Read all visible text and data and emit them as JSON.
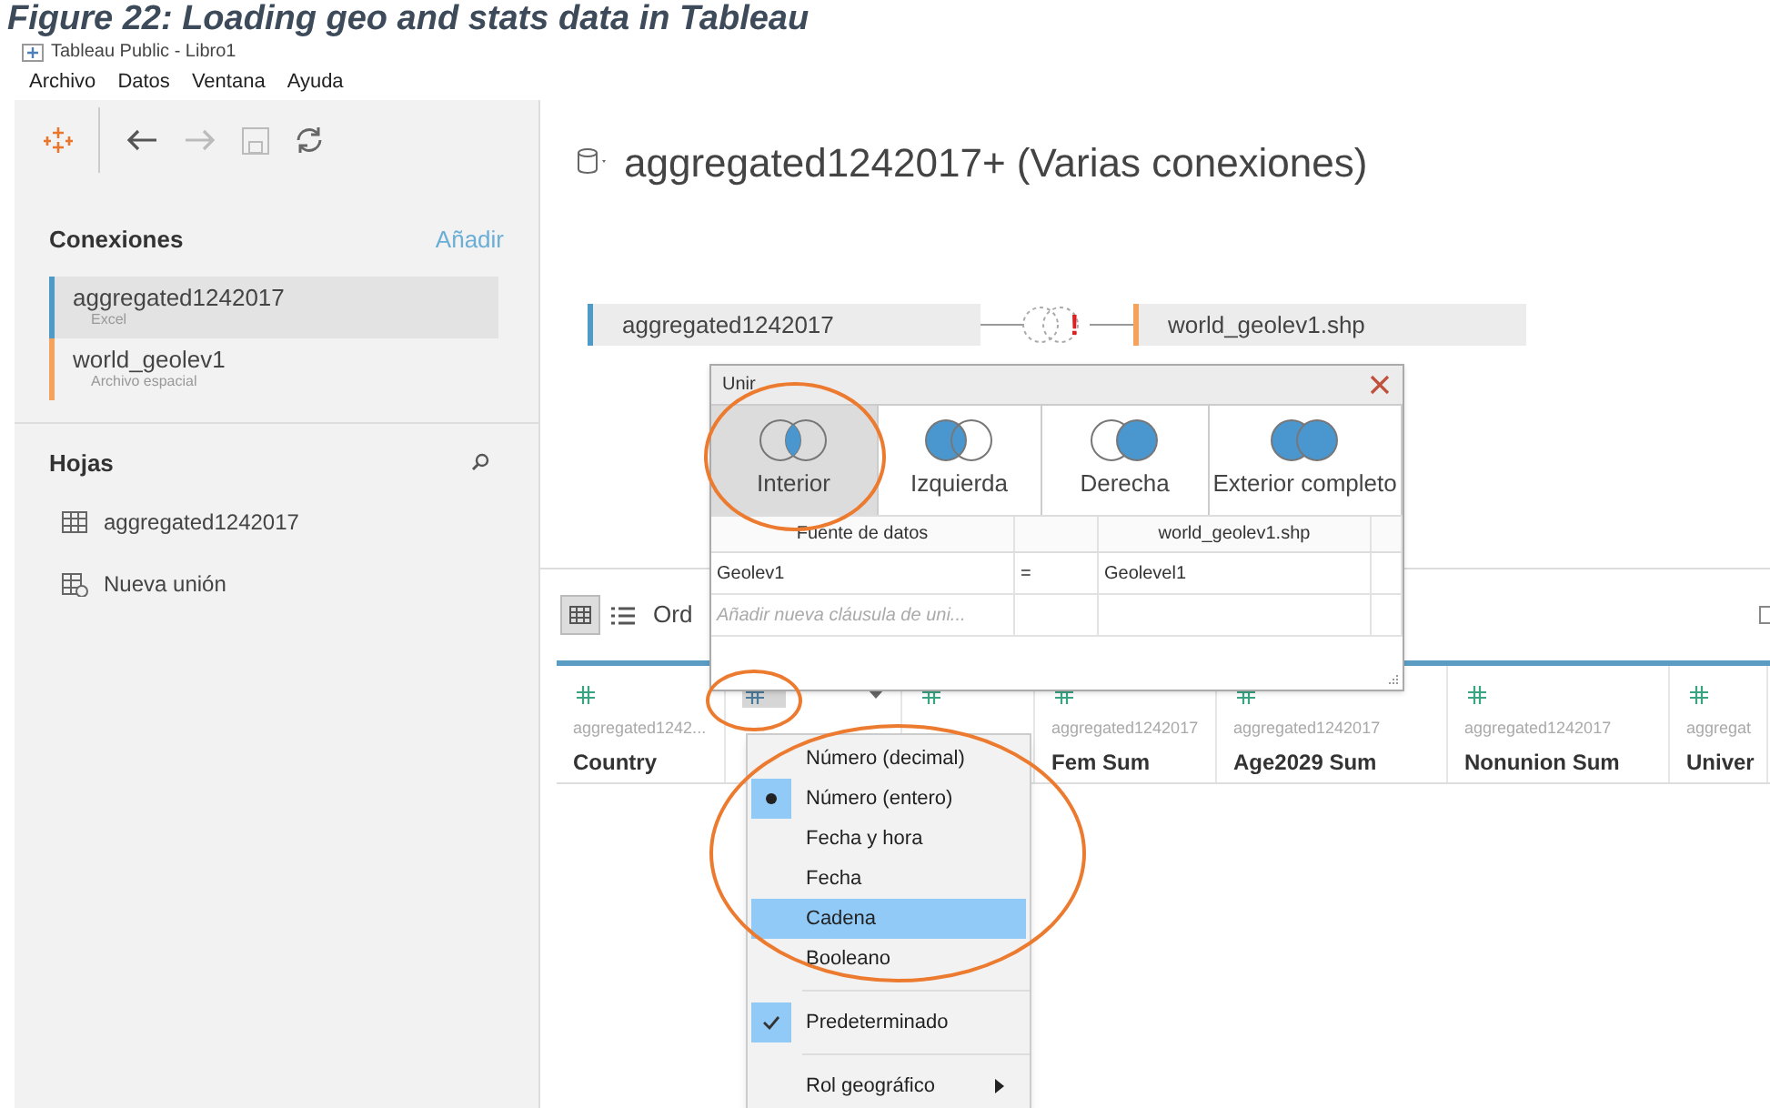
{
  "caption": "Figure 22: Loading geo and stats data in Tableau",
  "window": {
    "title": "Tableau Public - Libro1"
  },
  "menu": [
    "Archivo",
    "Datos",
    "Ventana",
    "Ayuda"
  ],
  "sidebar": {
    "connections_header": "Conexiones",
    "add_link": "Añadir",
    "connections": [
      {
        "name": "aggregated1242017",
        "subtitle": "Excel",
        "color": "#4f9bc8",
        "selected": true
      },
      {
        "name": "world_geolev1",
        "subtitle": "Archivo espacial",
        "color": "#f5a35c",
        "selected": false
      }
    ],
    "sheets_header": "Hojas",
    "sheets": [
      {
        "label": "aggregated1242017",
        "kind": "table"
      },
      {
        "label": "Nueva unión",
        "kind": "union"
      }
    ]
  },
  "main": {
    "title": "aggregated1242017+ (Varias conexiones)",
    "join_diagram": {
      "tables": [
        {
          "name": "aggregated1242017",
          "color": "#4f9bc8"
        },
        {
          "name": "world_geolev1.shp",
          "color": "#f5a35c"
        }
      ],
      "warning": "!"
    },
    "view_toolbar": {
      "sort_label": "Ord",
      "checkbox_checked": false
    },
    "columns": [
      {
        "source": "aggregated1242...",
        "name": "Country",
        "icon_selected": false,
        "dropdown": false
      },
      {
        "icon_selected": true,
        "dropdown": true
      },
      {
        "icon_selected": false,
        "dropdown": false
      },
      {
        "source": "aggregated1242017",
        "name": "Fem Sum",
        "icon_selected": false,
        "dropdown": false
      },
      {
        "source": "aggregated1242017",
        "name": "Age2029 Sum",
        "icon_selected": false,
        "dropdown": false
      },
      {
        "source": "aggregated1242017",
        "name": "Nonunion Sum",
        "icon_selected": false,
        "dropdown": false
      },
      {
        "source": "aggregat",
        "name": "Univer",
        "icon_selected": false,
        "dropdown": false
      }
    ],
    "join_dialog": {
      "title": "Unir",
      "types": [
        {
          "label": "Interior",
          "kind": "inner",
          "selected": true
        },
        {
          "label": "Izquierda",
          "kind": "left",
          "selected": false
        },
        {
          "label": "Derecha",
          "kind": "right",
          "selected": false
        },
        {
          "label": "Exterior completo",
          "kind": "full",
          "selected": false
        }
      ],
      "headers": [
        "Fuente de datos",
        "world_geolev1.shp"
      ],
      "clauses": [
        {
          "left": "Geolev1",
          "operator": "=",
          "right": "Geolevel1"
        }
      ],
      "placeholder": "Añadir nueva cláusula de uni..."
    },
    "type_menu": [
      {
        "kind": "option",
        "label": "Número (decimal)",
        "selected": false,
        "highlighted": false
      },
      {
        "kind": "option",
        "label": "Número (entero)",
        "selected": true,
        "highlighted": false
      },
      {
        "kind": "option",
        "label": "Fecha y hora",
        "selected": false,
        "highlighted": false
      },
      {
        "kind": "option",
        "label": "Fecha",
        "selected": false,
        "highlighted": false
      },
      {
        "kind": "option",
        "label": "Cadena",
        "selected": false,
        "highlighted": true
      },
      {
        "kind": "option",
        "label": "Booleano",
        "selected": false,
        "highlighted": false
      },
      {
        "kind": "separator"
      },
      {
        "kind": "check",
        "label": "Predeterminado",
        "checked": true
      },
      {
        "kind": "separator"
      },
      {
        "kind": "submenu",
        "label": "Rol geográfico"
      }
    ]
  },
  "annotations": [
    {
      "kind": "circle"
    },
    {
      "kind": "circle"
    },
    {
      "kind": "circle"
    }
  ]
}
